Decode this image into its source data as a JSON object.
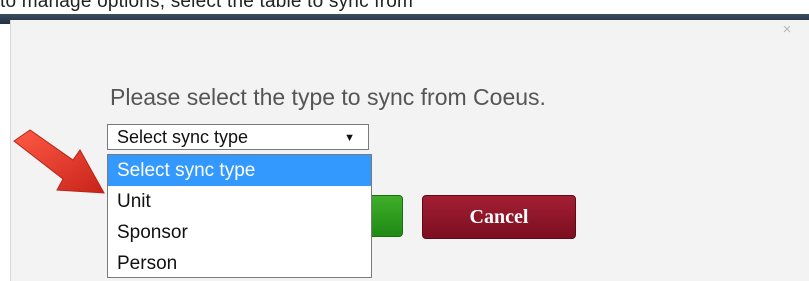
{
  "top_strip": {
    "text": "to manage options, select the table to sync from"
  },
  "dialog": {
    "close_label": "×",
    "prompt": "Please select the type to sync from Coeus.",
    "select": {
      "value": "Select sync type",
      "arrow": "▼",
      "options": [
        "Select sync type",
        "Unit",
        "Sponsor",
        "Person"
      ],
      "selected_index": 0
    },
    "cancel_label": "Cancel"
  },
  "colors": {
    "arrow": "#e8392b",
    "highlight": "#3399ff",
    "cancel": "#8f1628",
    "confirm": "#2a9c1c"
  },
  "icons": {
    "annotation": "red-arrow-icon",
    "close": "close-icon",
    "dropdown": "chevron-down-icon"
  }
}
